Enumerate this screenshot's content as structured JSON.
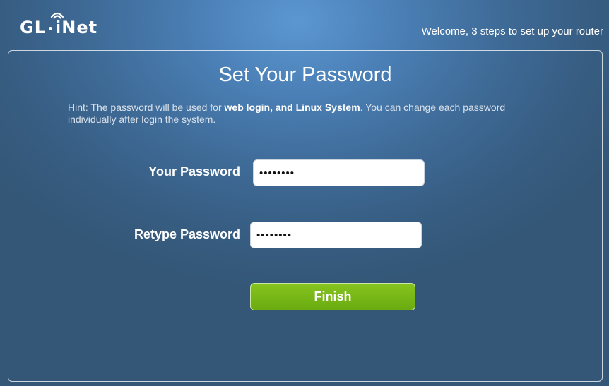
{
  "header": {
    "logo_part1": "GL",
    "logo_part2": "iNet",
    "welcome": "Welcome, 3 steps to set up your router"
  },
  "form": {
    "title": "Set Your Password",
    "hint_prefix": "Hint: The password will be used for ",
    "hint_bold": "web login, and Linux System",
    "hint_suffix": ". You can change each password individually after login the system.",
    "password_label": "Your Password",
    "password_value": "••••••••",
    "retype_label": "Retype Password",
    "retype_value": "••••••••",
    "finish_label": "Finish"
  },
  "colors": {
    "accent_green": "#78b818",
    "background_blue": "#4a7fb5"
  },
  "icons": {
    "logo_wifi": "wifi-icon"
  }
}
